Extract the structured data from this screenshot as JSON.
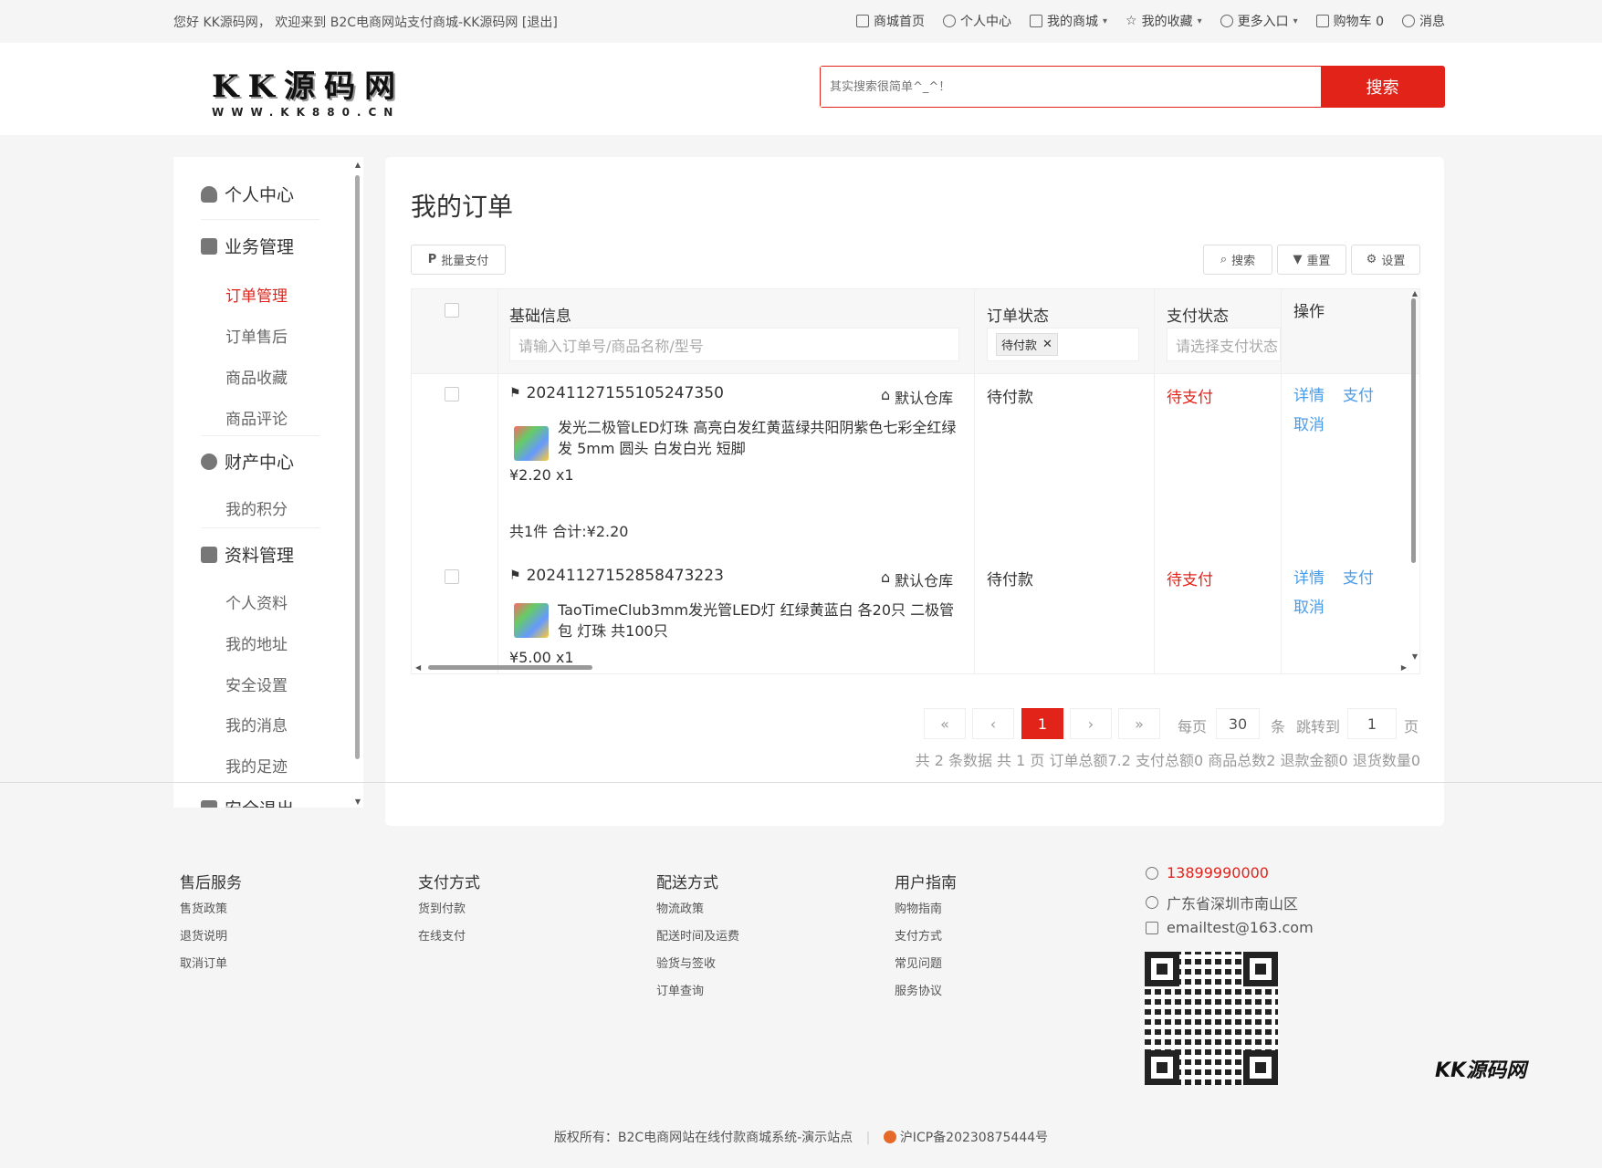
{
  "topbar": {
    "welcome": "您好 KK源码网， 欢迎来到 B2C电商网站支付商城-KK源码网 [退出]",
    "nav": [
      {
        "label": "商城首页",
        "icon": "home-icon"
      },
      {
        "label": "个人中心",
        "icon": "user-icon"
      },
      {
        "label": "我的商城",
        "icon": "shop-icon",
        "dropdown": true
      },
      {
        "label": "我的收藏",
        "icon": "star-icon",
        "dropdown": true
      },
      {
        "label": "更多入口",
        "icon": "more-icon",
        "dropdown": true
      },
      {
        "label": "购物车 0",
        "icon": "cart-icon"
      },
      {
        "label": "消息",
        "icon": "bell-icon"
      }
    ]
  },
  "header": {
    "logo_main": "KK源码网",
    "logo_sub": "WWW.KK880.CN",
    "search_placeholder": "其实搜索很简单^_^！",
    "search_button": "搜索"
  },
  "sidebar": {
    "personal_center": "个人中心",
    "business": "业务管理",
    "business_items": [
      "订单管理",
      "订单售后",
      "商品收藏",
      "商品评论"
    ],
    "finance": "财产中心",
    "finance_items": [
      "我的积分"
    ],
    "profile": "资料管理",
    "profile_items": [
      "个人资料",
      "我的地址",
      "安全设置",
      "我的消息",
      "我的足迹"
    ],
    "logout": "安全退出"
  },
  "main": {
    "title": "我的订单",
    "batch_pay": "批量支付",
    "search_btn": "搜索",
    "reset_btn": "重置",
    "settings_btn": "设置",
    "columns": {
      "basic": "基础信息",
      "order_status": "订单状态",
      "pay_status": "支付状态",
      "actions": "操作"
    },
    "filters": {
      "basic_placeholder": "请输入订单号/商品名称/型号",
      "order_status_tag": "待付款",
      "pay_status_placeholder": "请选择支付状态"
    },
    "orders": [
      {
        "order_no": "20241127155105247350",
        "warehouse": "默认仓库",
        "goods_name": "发光二极管LED灯珠 高亮白发红黄蓝绿共阳阴紫色七彩全红绿发 5mm 圆头 白发白光 短脚",
        "price_qty": "¥2.20 x1",
        "total": "共1件 合计:¥2.20",
        "order_status": "待付款",
        "pay_status": "待支付",
        "actions": [
          "详情",
          "支付",
          "取消"
        ]
      },
      {
        "order_no": "20241127152858473223",
        "warehouse": "默认仓库",
        "goods_name": "TaoTimeClub3mm发光管LED灯 红绿黄蓝白 各20只 二极管包 灯珠 共100只",
        "price_qty": "¥5.00 x1",
        "order_status": "待付款",
        "pay_status": "待支付",
        "actions": [
          "详情",
          "支付",
          "取消"
        ]
      }
    ],
    "pagination": {
      "first": "«",
      "prev": "‹",
      "current": "1",
      "next": "›",
      "last": "»",
      "per_page_label": "每页",
      "per_page": "30",
      "per_page_unit": "条",
      "jump_label": "跳转到",
      "jump_value": "1",
      "jump_unit": "页"
    },
    "summary": "共 2 条数据   共 1 页   订单总额7.2   支付总额0   商品总数2   退款金额0   退货数量0"
  },
  "footer": {
    "columns": [
      {
        "title": "售后服务",
        "links": [
          "售货政策",
          "退货说明",
          "取消订单"
        ]
      },
      {
        "title": "支付方式",
        "links": [
          "货到付款",
          "在线支付"
        ]
      },
      {
        "title": "配送方式",
        "links": [
          "物流政策",
          "配送时间及运费",
          "验货与签收",
          "订单查询"
        ]
      },
      {
        "title": "用户指南",
        "links": [
          "购物指南",
          "支付方式",
          "常见问题",
          "服务协议"
        ]
      }
    ],
    "phone": "13899990000",
    "address": "广东省深圳市南山区",
    "email": "emailtest@163.com",
    "brand_tag": "KK源码网",
    "copyright": "版权所有：B2C电商网站在线付款商城系统-演示站点",
    "icp": "沪ICP备20230875444号"
  },
  "colors": {
    "accent": "#e2231a",
    "link": "#4a9be6"
  }
}
